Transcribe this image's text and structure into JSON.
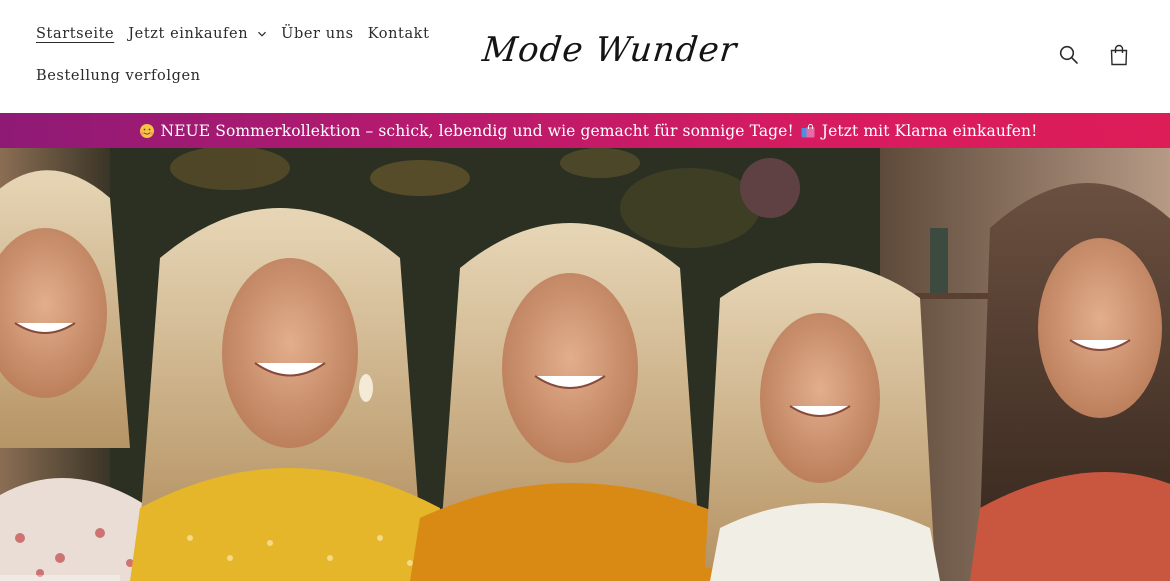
{
  "header": {
    "nav": [
      {
        "label": "Startseite",
        "active": true
      },
      {
        "label": "Jetzt einkaufen",
        "has_dropdown": true
      },
      {
        "label": "Über uns"
      },
      {
        "label": "Kontakt"
      },
      {
        "label": "Bestellung verfolgen"
      }
    ],
    "logo_text": "Mode Wunder",
    "icons": [
      "search-icon",
      "cart-icon"
    ]
  },
  "announcement": {
    "text": "NEUE Sommerkollektion – schick, lebendig und wie gemacht für sonnige Tage!",
    "cta": "Jetzt mit Klarna einkaufen!",
    "emoji_left": "smiling-face-icon",
    "emoji_right": "shopping-bags-icon",
    "gradient": [
      "#8e1a76",
      "#dd1d58"
    ]
  },
  "hero": {
    "image": "photo of five smiling women",
    "colors": {
      "yellow": "#e5b52a",
      "orange": "#d98a14",
      "coral": "#c9573f",
      "white": "#f1eee6"
    }
  }
}
